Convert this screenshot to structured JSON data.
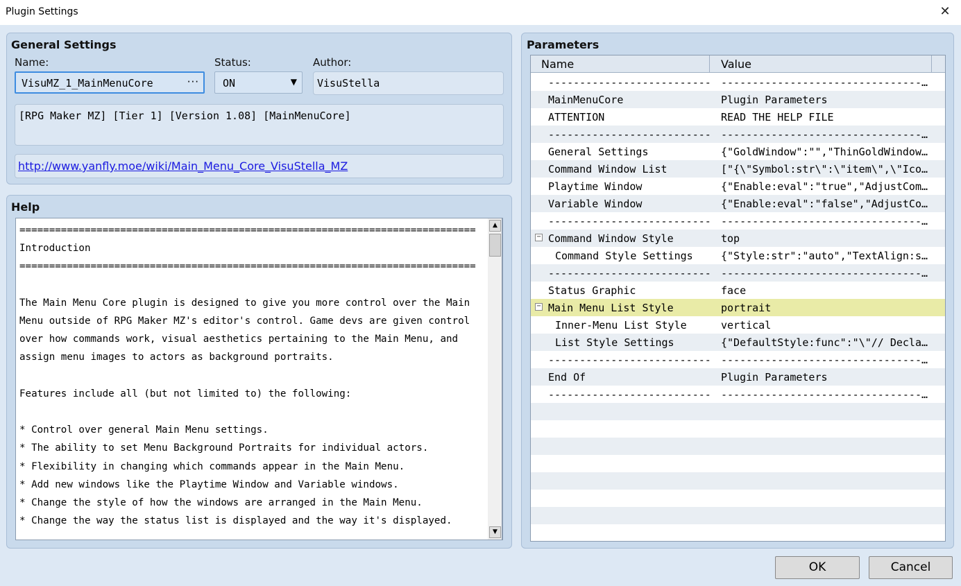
{
  "window": {
    "title": "Plugin Settings"
  },
  "general": {
    "title": "General Settings",
    "name_label": "Name:",
    "name_value": "VisuMZ_1_MainMenuCore",
    "name_browse": "···",
    "status_label": "Status:",
    "status_value": "ON",
    "author_label": "Author:",
    "author_value": "VisuStella",
    "description": "[RPG Maker MZ] [Tier 1] [Version 1.08] [MainMenuCore]",
    "url": "http://www.yanfly.moe/wiki/Main_Menu_Core_VisuStella_MZ"
  },
  "help": {
    "title": "Help",
    "lines": [
      "=============================================================================",
      "Introduction",
      "=============================================================================",
      "",
      "The Main Menu Core plugin is designed to give you more control over the Main",
      "Menu outside of RPG Maker MZ's editor's control. Game devs are given control",
      "over how commands work, visual aesthetics pertaining to the Main Menu, and",
      "assign menu images to actors as background portraits.",
      "",
      "Features include all (but not limited to) the following:",
      "",
      "* Control over general Main Menu settings.",
      "* The ability to set Menu Background Portraits for individual actors.",
      "* Flexibility in changing which commands appear in the Main Menu.",
      "* Add new windows like the Playtime Window and Variable windows.",
      "* Change the style of how the windows are arranged in the Main Menu.",
      "* Change the way the status list is displayed and the way it's displayed."
    ]
  },
  "params": {
    "title": "Parameters",
    "col_name": "Name",
    "col_value": "Value",
    "rows": [
      {
        "name": "--------------------------",
        "value": "-----------------------------------"
      },
      {
        "name": "MainMenuCore",
        "value": "Plugin Parameters"
      },
      {
        "name": "ATTENTION",
        "value": "READ THE HELP FILE"
      },
      {
        "name": "--------------------------",
        "value": "-----------------------------------"
      },
      {
        "name": "General Settings",
        "value": "{\"GoldWindow\":\"\",\"ThinGoldWindow\"···"
      },
      {
        "name": "Command Window List",
        "value": "[\"{\\\"Symbol:str\\\":\\\"item\\\",\\\"Ico···"
      },
      {
        "name": "Playtime Window",
        "value": "{\"Enable:eval\":\"true\",\"AdjustCom···"
      },
      {
        "name": "Variable Window",
        "value": "{\"Enable:eval\":\"false\",\"AdjustCo···"
      },
      {
        "name": "--------------------------",
        "value": "-----------------------------------"
      },
      {
        "name": "Command Window Style",
        "value": "top",
        "toggle": "⊟"
      },
      {
        "name": "Command Style Settings",
        "value": "{\"Style:str\":\"auto\",\"TextAlign:s···",
        "indent": true
      },
      {
        "name": "--------------------------",
        "value": "-----------------------------------"
      },
      {
        "name": "Status Graphic",
        "value": "face"
      },
      {
        "name": "Main Menu List Style",
        "value": "portrait",
        "toggle": "⊟",
        "selected": true
      },
      {
        "name": "Inner-Menu List Style",
        "value": "vertical",
        "indent": true
      },
      {
        "name": "List Style Settings",
        "value": "{\"DefaultStyle:func\":\"\\\"// Decla···",
        "indent": true
      },
      {
        "name": "--------------------------",
        "value": "-----------------------------------"
      },
      {
        "name": "End Of",
        "value": "Plugin Parameters"
      },
      {
        "name": "--------------------------",
        "value": "-----------------------------------"
      },
      {
        "name": "",
        "value": ""
      },
      {
        "name": "",
        "value": ""
      },
      {
        "name": "",
        "value": ""
      },
      {
        "name": "",
        "value": ""
      },
      {
        "name": "",
        "value": ""
      },
      {
        "name": "",
        "value": ""
      },
      {
        "name": "",
        "value": ""
      },
      {
        "name": "",
        "value": ""
      }
    ]
  },
  "buttons": {
    "ok": "OK",
    "cancel": "Cancel"
  },
  "colors": {
    "selected_row": "#e9eba7",
    "link": "#1a1ae0",
    "focus_border": "#3d8ce0"
  }
}
